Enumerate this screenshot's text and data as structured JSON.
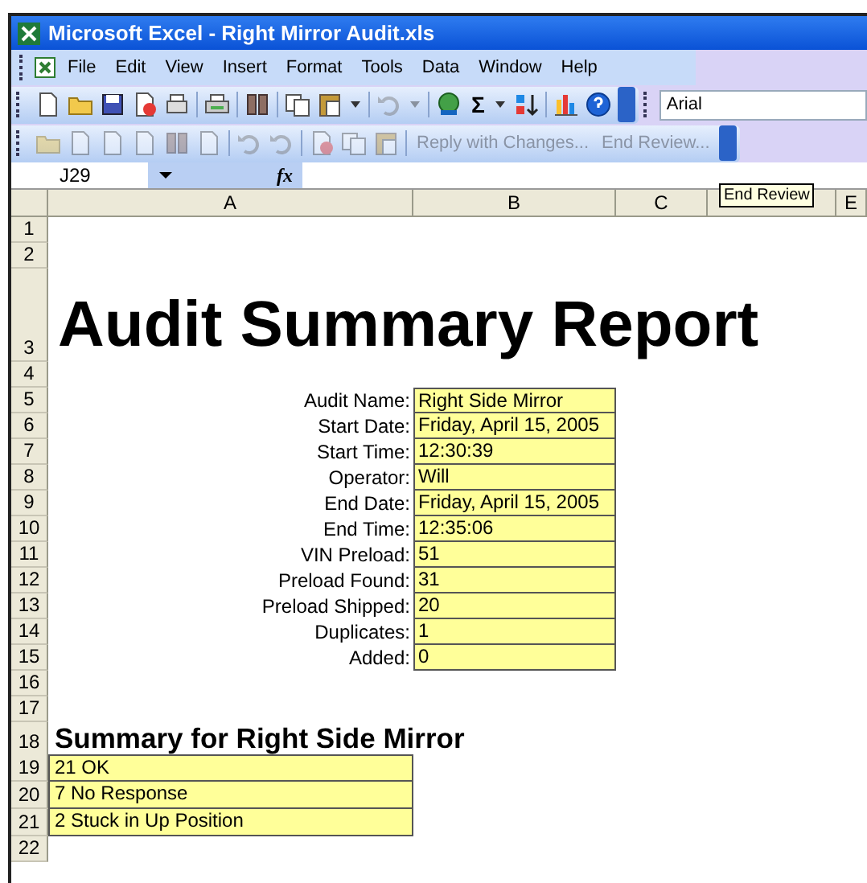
{
  "window": {
    "title": "Microsoft Excel - Right Mirror Audit.xls"
  },
  "menu": [
    "File",
    "Edit",
    "View",
    "Insert",
    "Format",
    "Tools",
    "Data",
    "Window",
    "Help"
  ],
  "toolbar": {
    "sum_symbol": "Σ",
    "font": "Arial"
  },
  "review_toolbar": {
    "buttons": [
      {
        "label": "Reply with Changes...",
        "disabled": true
      },
      {
        "label": "End Review...",
        "disabled": true
      }
    ]
  },
  "formula_bar": {
    "name_box": "J29",
    "function_label": "fx"
  },
  "tooltip": "End Review",
  "columns": [
    {
      "label": "A"
    },
    {
      "label": "B"
    },
    {
      "label": "C"
    },
    {},
    {
      "label": "E"
    }
  ],
  "rows": [
    {
      "number": "1"
    },
    {
      "number": "2"
    },
    {
      "number": "3",
      "kind": "title",
      "text": "Audit Summary Report"
    },
    {
      "number": "4"
    },
    {
      "number": "5",
      "kind": "field",
      "label": "Audit Name:",
      "value": "Right Side Mirror"
    },
    {
      "number": "6",
      "kind": "field",
      "label": "Start Date:",
      "value": "Friday, April 15, 2005"
    },
    {
      "number": "7",
      "kind": "field",
      "label": "Start Time:",
      "value": "12:30:39"
    },
    {
      "number": "8",
      "kind": "field",
      "label": "Operator:",
      "value": "Will"
    },
    {
      "number": "9",
      "kind": "field",
      "label": "End Date:",
      "value": "Friday, April 15, 2005"
    },
    {
      "number": "10",
      "kind": "field",
      "label": "End Time:",
      "value": "12:35:06"
    },
    {
      "number": "11",
      "kind": "field",
      "label": "VIN Preload:",
      "value": "51"
    },
    {
      "number": "12",
      "kind": "field",
      "label": "Preload Found:",
      "value": "31"
    },
    {
      "number": "13",
      "kind": "field",
      "label": "Preload Shipped:",
      "value": "20"
    },
    {
      "number": "14",
      "kind": "field",
      "label": "Duplicates:",
      "value": "1"
    },
    {
      "number": "15",
      "kind": "field",
      "label": "Added:",
      "value": "0"
    },
    {
      "number": "16"
    },
    {
      "number": "17"
    },
    {
      "number": "18",
      "kind": "heading",
      "text": "Summary for Right Side Mirror"
    },
    {
      "number": "19",
      "kind": "result",
      "text": "21 OK"
    },
    {
      "number": "20",
      "kind": "result",
      "text": "7 No Response"
    },
    {
      "number": "21",
      "kind": "result",
      "text": "2 Stuck in Up Position"
    },
    {
      "number": "22"
    }
  ]
}
